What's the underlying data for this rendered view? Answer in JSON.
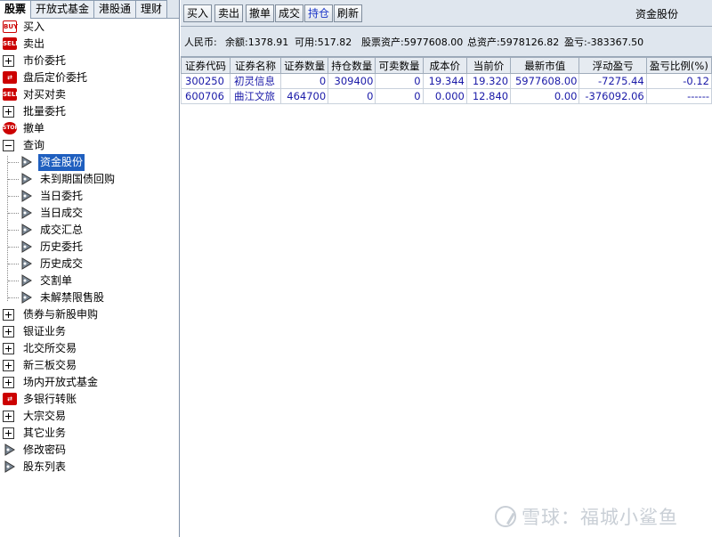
{
  "tabs": [
    {
      "label": "股票",
      "active": true
    },
    {
      "label": "开放式基金",
      "active": false
    },
    {
      "label": "港股通",
      "active": false
    },
    {
      "label": "理财",
      "active": false
    }
  ],
  "tree": {
    "buy": "买入",
    "sell": "卖出",
    "market_order": "市价委托",
    "after_hours": "盘后定价委托",
    "pair_trade": "对买对卖",
    "batch_order": "批量委托",
    "cancel": "撤单",
    "query": "查询",
    "query_children": [
      "资金股份",
      "未到期国债回购",
      "当日委托",
      "当日成交",
      "成交汇总",
      "历史委托",
      "历史成交",
      "交割单",
      "未解禁限售股"
    ],
    "bonds_ipo": "债券与新股申购",
    "bank_securities": "银证业务",
    "bse_trading": "北交所交易",
    "neeq_trading": "新三板交易",
    "exchange_fund": "场内开放式基金",
    "multi_bank": "多银行转账",
    "block_trade": "大宗交易",
    "other": "其它业务",
    "change_password": "修改密码",
    "shareholder_list": "股东列表"
  },
  "toolbar": {
    "buttons": [
      "买入",
      "卖出",
      "撤单",
      "成交",
      "持仓",
      "刷新"
    ],
    "active": "持仓",
    "title": "资金股份"
  },
  "summary": {
    "currency": "人民币:",
    "balance": "余额:1378.91",
    "available": "可用:517.82",
    "stock_assets": "股票资产:5977608.00",
    "total_assets": "总资产:5978126.82",
    "pnl": "盈亏:-383367.50"
  },
  "table": {
    "columns": [
      "证券代码",
      "证券名称",
      "证券数量",
      "持仓数量",
      "可卖数量",
      "成本价",
      "当前价",
      "最新市值",
      "浮动盈亏",
      "盈亏比例(%)"
    ],
    "rows": [
      [
        "300250",
        "初灵信息",
        "0",
        "309400",
        "0",
        "19.344",
        "19.320",
        "5977608.00",
        "-7275.44",
        "-0.12"
      ],
      [
        "600706",
        "曲江文旅",
        "464700",
        "0",
        "0",
        "0.000",
        "12.840",
        "0.00",
        "-376092.06",
        "------"
      ]
    ]
  },
  "watermark": "雪球：福城小鲨鱼"
}
